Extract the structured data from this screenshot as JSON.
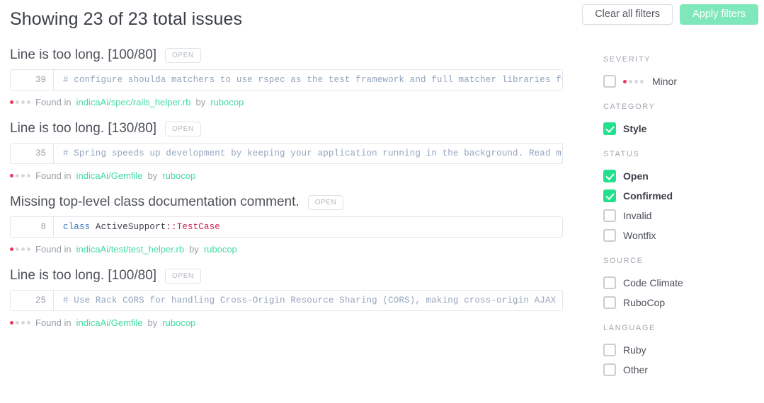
{
  "header": {
    "title": "Showing 23 of 23 total issues",
    "clear_label": "Clear all filters",
    "apply_label": "Apply filters",
    "apply_color": "#7fe8bb"
  },
  "issues": [
    {
      "title": "Line is too long. [100/80]",
      "status_badge": "OPEN",
      "line_number": "39",
      "code": "# configure shoulda matchers to use rspec as the test framework and full matcher libraries for",
      "code_kind": "comment",
      "severity_level": 1,
      "severity_total": 4,
      "found_prefix": "Found in",
      "file": "indicaAi/spec/rails_helper.rb",
      "by_word": "by",
      "engine": "rubocop"
    },
    {
      "title": "Line is too long. [130/80]",
      "status_badge": "OPEN",
      "line_number": "35",
      "code": "# Spring speeds up development by keeping your application running in the background. Read m",
      "code_kind": "comment",
      "severity_level": 1,
      "severity_total": 4,
      "found_prefix": "Found in",
      "file": "indicaAi/Gemfile",
      "by_word": "by",
      "engine": "rubocop"
    },
    {
      "title": "Missing top-level class documentation comment.",
      "status_badge": "OPEN",
      "line_number": "8",
      "code": "class ActiveSupport::TestCase",
      "code_kind": "ruby_class",
      "code_tokens": {
        "keyword": "class",
        "plain": " ActiveSupport",
        "constant": "::TestCase"
      },
      "severity_level": 1,
      "severity_total": 4,
      "found_prefix": "Found in",
      "file": "indicaAi/test/test_helper.rb",
      "by_word": "by",
      "engine": "rubocop"
    },
    {
      "title": "Line is too long. [100/80]",
      "status_badge": "OPEN",
      "line_number": "25",
      "code": "# Use Rack CORS for handling Cross-Origin Resource Sharing (CORS), making cross-origin AJAX po",
      "code_kind": "comment",
      "severity_level": 1,
      "severity_total": 4,
      "found_prefix": "Found in",
      "file": "indicaAi/Gemfile",
      "by_word": "by",
      "engine": "rubocop"
    }
  ],
  "filters": [
    {
      "group": "SEVERITY",
      "options": [
        {
          "label": "Minor",
          "checked": false,
          "dots": 1,
          "dots_total": 4
        }
      ]
    },
    {
      "group": "CATEGORY",
      "options": [
        {
          "label": "Style",
          "checked": true
        }
      ]
    },
    {
      "group": "STATUS",
      "options": [
        {
          "label": "Open",
          "checked": true
        },
        {
          "label": "Confirmed",
          "checked": true
        },
        {
          "label": "Invalid",
          "checked": false
        },
        {
          "label": "Wontfix",
          "checked": false
        }
      ]
    },
    {
      "group": "SOURCE",
      "options": [
        {
          "label": "Code Climate",
          "checked": false
        },
        {
          "label": "RuboCop",
          "checked": false
        }
      ]
    },
    {
      "group": "LANGUAGE",
      "options": [
        {
          "label": "Ruby",
          "checked": false
        },
        {
          "label": "Other",
          "checked": false
        }
      ]
    }
  ],
  "colors": {
    "accent_green": "#23e08d",
    "link_green": "#43dca0",
    "severity_red": "#e8385f",
    "comment_blue": "#93a4bd",
    "keyword_blue": "#3a77c2",
    "constant_crimson": "#c7254e"
  }
}
